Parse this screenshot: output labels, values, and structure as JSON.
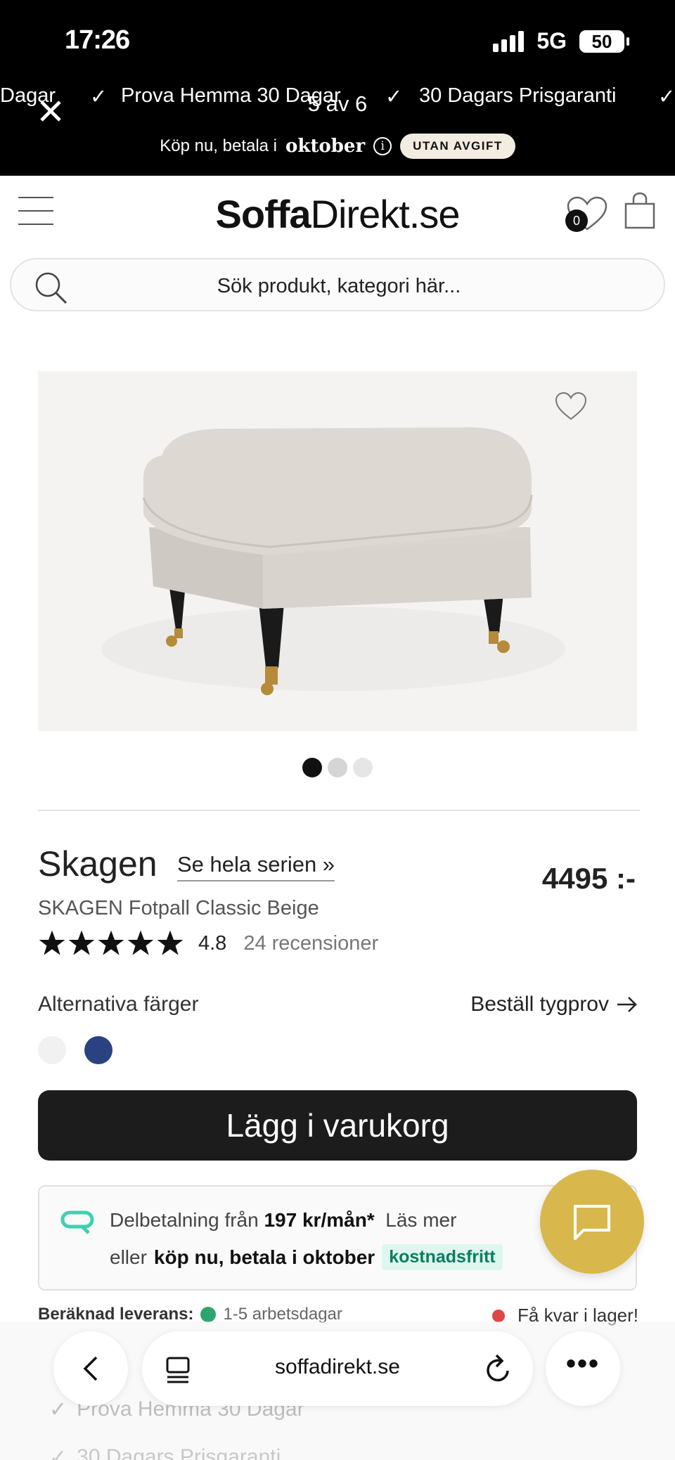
{
  "status_bar": {
    "time": "17:26",
    "network": "5G",
    "battery": "50"
  },
  "viewer": {
    "counter": "5 av 6",
    "close_icon": "close-icon"
  },
  "promo": {
    "marquee": [
      "Dagar",
      "Prova Hemma 30 Dagar",
      "30 Dagars Prisgaranti"
    ],
    "pay_prefix": "Köp nu, betala i",
    "pay_month": "oktober",
    "free_label": "UTAN AVGIFT"
  },
  "header": {
    "logo_bold": "Soffa",
    "logo_rest": "Direkt.se",
    "wishlist_count": "0"
  },
  "search": {
    "placeholder": "Sök produkt, kategori här..."
  },
  "product": {
    "series": "Skagen",
    "series_link": "Se hela serien »",
    "price": "4495 :-",
    "name": "SKAGEN Fotpall Classic Beige",
    "rating": "4.8",
    "stars": 5,
    "reviews": "24 recensioner",
    "alt_colors_label": "Alternativa färger",
    "fabric_sample": "Beställ tygprov",
    "colors": [
      "#f1f1f1",
      "#2a4380"
    ],
    "gallery": {
      "slides": 3,
      "active": 1
    },
    "add_to_cart": "Lägg i varukorg"
  },
  "finance": {
    "prefix": "Delbetalning från",
    "amount": "197 kr/mån*",
    "read_more": "Läs mer",
    "or": "eller",
    "pay_later": "köp nu, betala i oktober",
    "free": "kostnadsfritt"
  },
  "delivery": {
    "label": "Beräknad leverans:",
    "value": "1-5 arbetsdagar",
    "stock": "Få kvar i lager!"
  },
  "below_fold": {
    "line1": "Prova Hemma 30 Dagar",
    "line2": "30 Dagars Prisgaranti"
  },
  "browser": {
    "domain": "soffadirekt.se"
  }
}
